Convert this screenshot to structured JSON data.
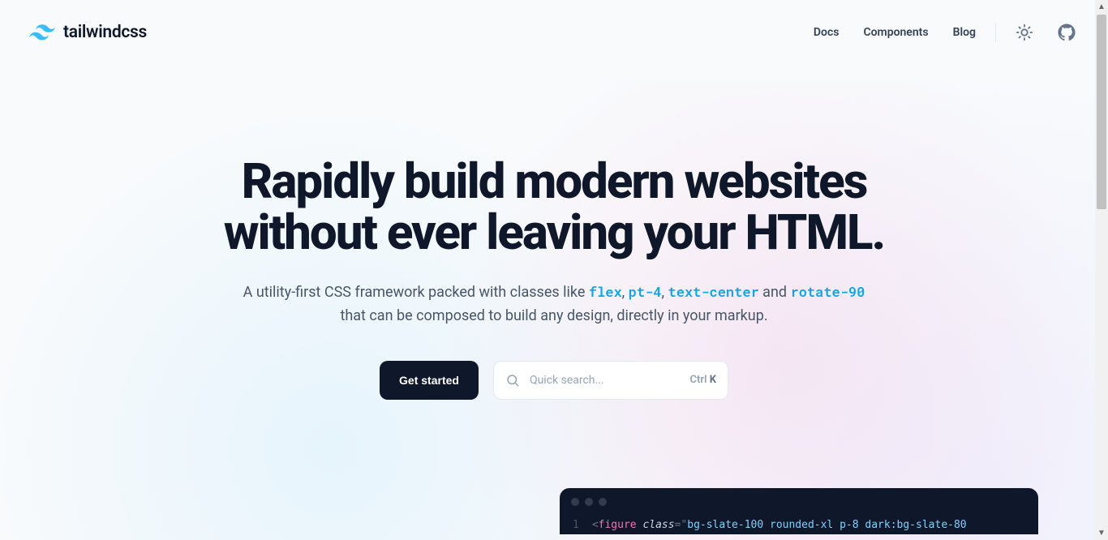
{
  "brand": {
    "name": "tailwindcss"
  },
  "nav": {
    "items": [
      {
        "label": "Docs"
      },
      {
        "label": "Components"
      },
      {
        "label": "Blog"
      }
    ]
  },
  "hero": {
    "headline_l1": "Rapidly build modern websites",
    "headline_l2": "without ever leaving your HTML.",
    "sub_pre": "A utility-first CSS framework packed with classes like ",
    "chips": [
      "flex",
      "pt-4",
      "text-center",
      "rotate-90"
    ],
    "sep_comma": ", ",
    "sep_and": " and ",
    "sub_post": " that can be composed to build any design, directly in your markup."
  },
  "cta": {
    "primary": "Get started",
    "search_placeholder": "Quick search...",
    "kbd_mod": "Ctrl ",
    "kbd_key": "K"
  },
  "editor": {
    "line_no": "1",
    "tag": "figure",
    "attr": "class",
    "value": "bg-slate-100 rounded-xl p-8 dark:bg-slate-80"
  }
}
